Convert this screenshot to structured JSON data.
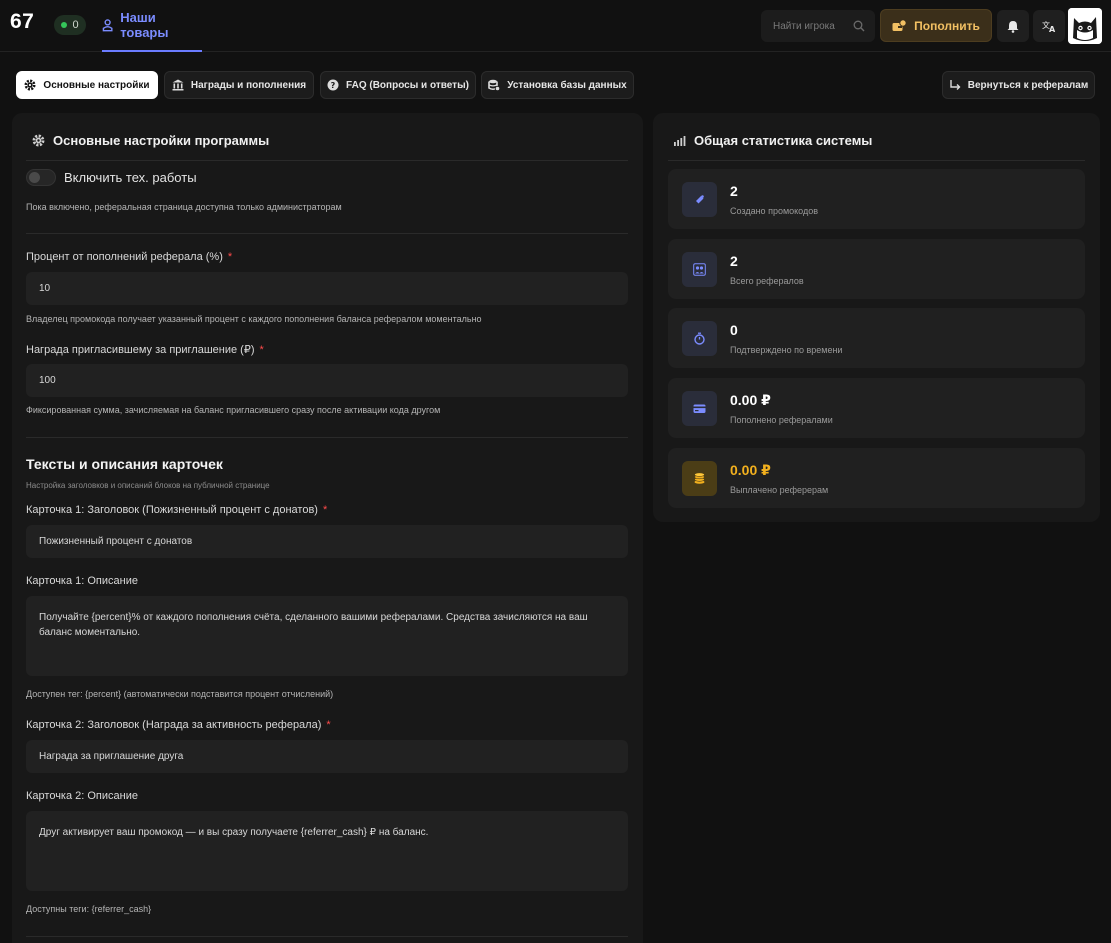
{
  "header": {
    "logo": "67",
    "online_count": "0",
    "nav_tab_label": "Наши товары",
    "search_placeholder": "Найти игрока",
    "topup_label": "Пополнить"
  },
  "tabs": [
    {
      "label": "Основные настройки",
      "active": true,
      "icon": "gear-icon"
    },
    {
      "label": "Награды и пополнения",
      "active": false,
      "icon": "bank-icon"
    },
    {
      "label": "FAQ (Вопросы и ответы)",
      "active": false,
      "icon": "help-icon"
    },
    {
      "label": "Установка базы данных",
      "active": false,
      "icon": "database-icon"
    }
  ],
  "back_button_label": "Вернуться к рефералам",
  "settings": {
    "title": "Основные настройки программы",
    "maintenance_label": "Включить тех. работы",
    "maintenance_enabled": false,
    "maintenance_hint": "Пока включено, реферальная страница доступна только администраторам",
    "percent_label": "Процент от пополнений реферала (%)",
    "percent_value": "10",
    "percent_hint": "Владелец промокода получает указанный процент с каждого пополнения баланса рефералом моментально",
    "reward_label": "Награда пригласившему за приглашение (₽)",
    "reward_value": "100",
    "reward_hint": "Фиксированная сумма, зачисляемая на баланс пригласившего сразу после активации кода другом",
    "texts_heading": "Тексты и описания карточек",
    "texts_subheading": "Настройка заголовков и описаний блоков на публичной странице",
    "card1_title_label": "Карточка 1: Заголовок (Пожизненный процент с донатов)",
    "card1_title_value": "Пожизненный процент с донатов",
    "card1_desc_label": "Карточка 1: Описание",
    "card1_desc_value": "Получайте {percent}% от каждого пополнения счёта, сделанного вашими рефералами. Средства зачисляются на ваш баланс моментально.",
    "card1_tag_hint": "Доступен тег: {percent} (автоматически подставится процент отчислений)",
    "card2_title_label": "Карточка 2: Заголовок (Награда за активность реферала)",
    "card2_title_value": "Награда за приглашение друга",
    "card2_desc_label": "Карточка 2: Описание",
    "card2_desc_value": "Друг активирует ваш промокод — и вы сразу получаете {referrer_cash} ₽ на баланс.",
    "card2_tag_hint": "Доступны теги: {referrer_cash}"
  },
  "stats": {
    "title": "Общая статистика системы",
    "items": [
      {
        "value": "2",
        "label": "Создано промокодов",
        "icon": "ticket-icon"
      },
      {
        "value": "2",
        "label": "Всего рефералов",
        "icon": "users-icon"
      },
      {
        "value": "0",
        "label": "Подтверждено по времени",
        "icon": "timer-icon"
      },
      {
        "value": "0.00 ₽",
        "label": "Пополнено рефералами",
        "icon": "card-icon"
      },
      {
        "value": "0.00 ₽",
        "label": "Выплачено реферерам",
        "icon": "coins-icon"
      }
    ]
  },
  "colors": {
    "accent": "#7b8cff",
    "gold": "#f2b01e",
    "required": "#ff4b4b",
    "background": "#111111",
    "panel": "#181818"
  }
}
